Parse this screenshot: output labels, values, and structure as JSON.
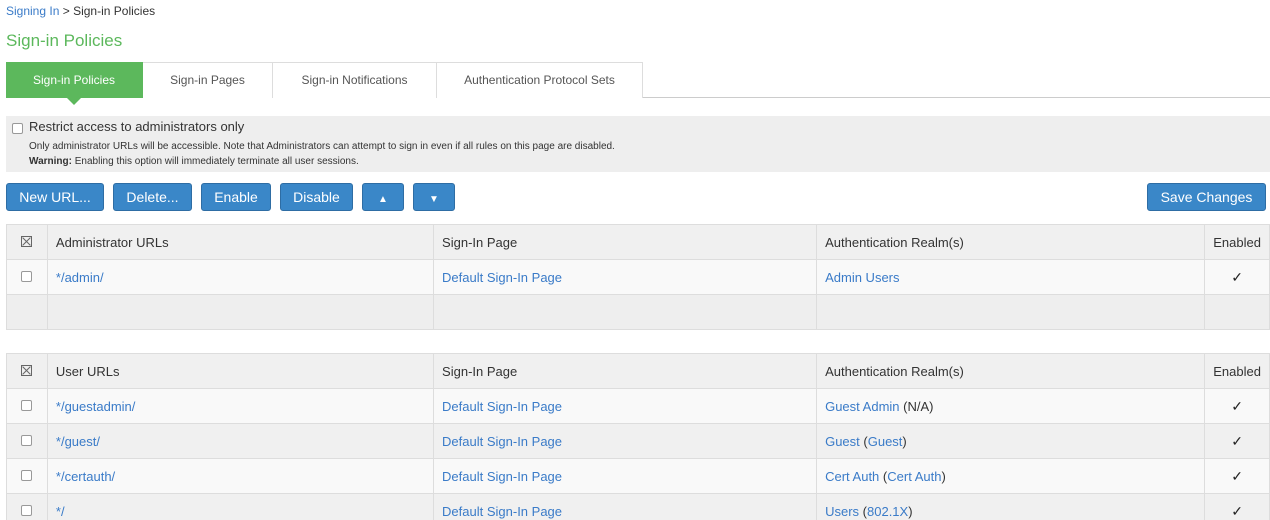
{
  "breadcrumb": {
    "link": "Signing In",
    "separator": ">",
    "current": "Sign-in Policies"
  },
  "page_title": "Sign-in Policies",
  "tabs": [
    {
      "label": "Sign-in Policies",
      "active": true
    },
    {
      "label": "Sign-in Pages"
    },
    {
      "label": "Sign-in Notifications"
    },
    {
      "label": "Authentication Protocol Sets"
    }
  ],
  "notice": {
    "checkbox_label": "Restrict access to administrators only",
    "line1": "Only administrator URLs will be accessible. Note that Administrators can attempt to sign in even if all rules on this page are disabled.",
    "warning_label": "Warning:",
    "warning_text": " Enabling this option will immediately terminate all user sessions."
  },
  "toolbar": {
    "new_url": "New URL...",
    "delete": "Delete...",
    "enable": "Enable",
    "disable": "Disable",
    "move_up": "🡅",
    "move_down": "🡇",
    "save": "Save Changes"
  },
  "admin_table": {
    "headers": [
      "Administrator URLs",
      "Sign-In Page",
      "Authentication Realm(s)",
      "Enabled"
    ],
    "rows": [
      {
        "url": "*/admin/",
        "page": "Default Sign-In Page",
        "realm": "Admin Users",
        "realm_extra_prefix": "",
        "realm_extra": "",
        "realm_extra_suffix": "",
        "enabled": "✓"
      }
    ]
  },
  "user_table": {
    "headers": [
      "User URLs",
      "Sign-In Page",
      "Authentication Realm(s)",
      "Enabled"
    ],
    "rows": [
      {
        "url": "*/guestadmin/",
        "page": "Default Sign-In Page",
        "realm": "Guest Admin",
        "realm_plain": " (N/A)",
        "enabled": "✓"
      },
      {
        "url": "*/guest/",
        "page": "Default Sign-In Page",
        "realm": "Guest",
        "realm_extra": "Guest",
        "enabled": "✓"
      },
      {
        "url": "*/certauth/",
        "page": "Default Sign-In Page",
        "realm": "Cert Auth",
        "realm_extra": "Cert Auth",
        "enabled": "✓"
      },
      {
        "url": "*/",
        "page": "Default Sign-In Page",
        "realm": "Users",
        "realm_extra": "802.1X",
        "enabled": "✓"
      }
    ]
  }
}
